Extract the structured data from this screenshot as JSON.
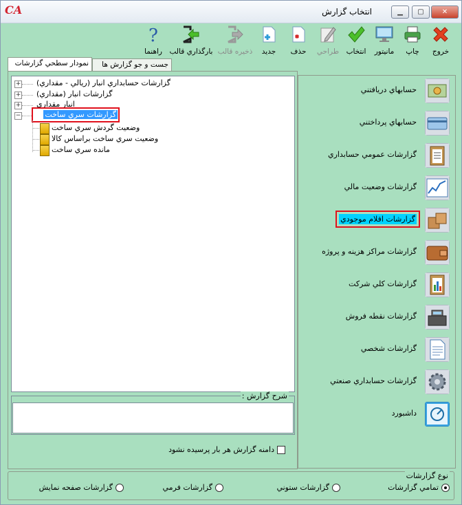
{
  "window": {
    "title": "انتخاب گزارش",
    "logo": "CA"
  },
  "toolbar": [
    {
      "name": "exit-button",
      "label": "خروج",
      "icon": "red-x-icon",
      "disabled": false
    },
    {
      "name": "print-button",
      "label": "چاپ",
      "icon": "printer-icon",
      "disabled": false
    },
    {
      "name": "monitor-button",
      "label": "مانيتور",
      "icon": "monitor-icon",
      "disabled": false
    },
    {
      "name": "select-button",
      "label": "انتخاب",
      "icon": "checkmark-icon",
      "disabled": false
    },
    {
      "name": "design-button",
      "label": "طراحي",
      "icon": "pencil-icon",
      "disabled": true
    },
    {
      "name": "delete-button",
      "label": "حذف",
      "icon": "delete-doc-icon",
      "disabled": false
    },
    {
      "name": "new-button",
      "label": "جديد",
      "icon": "new-doc-icon",
      "disabled": false
    },
    {
      "name": "save-template-button",
      "label": "ذخيره قالب",
      "icon": "export-arrow-icon",
      "disabled": true
    },
    {
      "name": "load-template-button",
      "label": "بارگذاري قالب",
      "icon": "import-arrow-icon",
      "disabled": false
    },
    {
      "name": "help-button",
      "label": "راهنما",
      "icon": "question-icon",
      "disabled": false
    }
  ],
  "tabs": {
    "tree": "نمودار سطحي گزارشات",
    "search": "جست و جو گزارش ها"
  },
  "tree": {
    "nodes": [
      {
        "label": "گزارشات حسابداري انبار (ريالي - مقداري)",
        "expander": "+"
      },
      {
        "label": "گزارشات انبار (مقداري)",
        "expander": "+"
      },
      {
        "label": "انبار مقداري",
        "expander": "+"
      },
      {
        "label": "گزارشات سري ساخت",
        "expander": "−"
      }
    ],
    "children": [
      "وضعيت گردش سري ساخت",
      "وضعيت سري ساخت براساس کالا",
      "مانده سري ساخت"
    ]
  },
  "description": {
    "legend": "شرح گزارش :",
    "text": ""
  },
  "checkbox": {
    "label": "دامنه گزارش هر بار پرسيده نشود",
    "checked": false
  },
  "categories": [
    {
      "label": "حسابهاي دريافتني",
      "icon": "receivable-icon"
    },
    {
      "label": "حسابهاي پرداختني",
      "icon": "payable-card-icon"
    },
    {
      "label": "گزارشات عمومي حسابداري",
      "icon": "clipboard-icon"
    },
    {
      "label": "گزارشات وضعيت مالي",
      "icon": "line-chart-icon"
    },
    {
      "label": "گزارشات اقلام موجودي",
      "icon": "boxes-icon"
    },
    {
      "label": "گزارشات مراکز هزينه و پروژه",
      "icon": "wallet-icon"
    },
    {
      "label": "گزارشات کلي شرکت",
      "icon": "bar-clipboard-icon"
    },
    {
      "label": "گزارشات نقطه فروش",
      "icon": "cash-register-icon"
    },
    {
      "label": "گزارشات شخصي",
      "icon": "document-icon"
    },
    {
      "label": "گزارشات حسابداري صنعتي",
      "icon": "gear-icon"
    },
    {
      "label": "داشبورد",
      "icon": "dashboard-icon"
    }
  ],
  "report_type": {
    "legend": "نوع گزارشات",
    "options": [
      {
        "label": "تمامي گزارشات",
        "selected": true
      },
      {
        "label": "گزارشات ستوني",
        "selected": false
      },
      {
        "label": "گزارشات فرمي",
        "selected": false
      },
      {
        "label": "گزارشات صفحه نمايش",
        "selected": false
      }
    ]
  }
}
